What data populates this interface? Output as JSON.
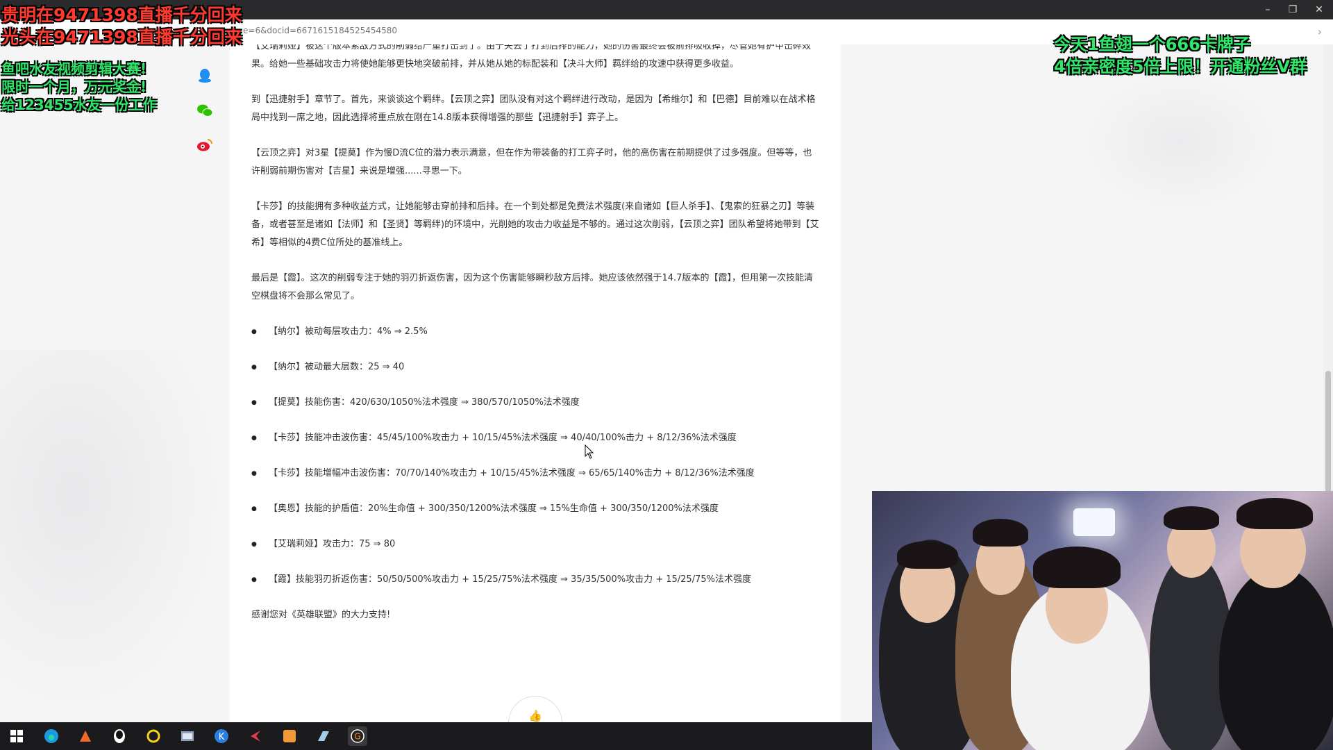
{
  "browser": {
    "url": "e=6&docid=6671615184525454580",
    "forward_icon": "chevron-right-icon"
  },
  "article": {
    "paragraphs": [
      "【艾瑞莉娅】被这个版本紧敌方式的削弱给严重打击到了。由于失去了打到后排的能力，她的伤害最终会被前排吸收掉，尽管她有护甲击碎效果。给她一些基础攻击力将使她能够更快地突破前排，并从她从她的标配装和【决斗大师】羁绊给的攻速中获得更多收益。",
      "到【迅捷射手】章节了。首先，来谈谈这个羁绊。【云顶之弈】团队没有对这个羁绊进行改动，是因为【希维尔】和【巴德】目前难以在战术格局中找到一席之地，因此选择将重点放在刚在14.8版本获得增强的那些【迅捷射手】弈子上。",
      "【云顶之弈】对3星【提莫】作为慢D流C位的潜力表示满意，但在作为带装备的打工弈子时，他的高伤害在前期提供了过多强度。但等等，也许削弱前期伤害对【吉星】来说是增强......寻思一下。",
      "【卡莎】的技能拥有多种收益方式，让她能够击穿前排和后排。在一个到处都是免费法术强度(来自诸如【巨人杀手】、【鬼索的狂暴之刃】等装备，或者甚至是诸如【法师】和【圣贤】等羁绊)的环境中，光削她的攻击力收益是不够的。通过这次削弱，【云顶之弈】团队希望将她带到【艾希】等相似的4费C位所处的基准线上。",
      "最后是【霞】。这次的削弱专注于她的羽刃折返伤害，因为这个伤害能够瞬秒敌方后排。她应该依然强于14.7版本的【霞】，但用第一次技能清空棋盘将不会那么常见了。"
    ],
    "bullets": [
      "【纳尔】被动每层攻击力：4% ⇒ 2.5%",
      "【纳尔】被动最大层数：25 ⇒ 40",
      "【提莫】技能伤害：420/630/1050%法术强度 ⇒ 380/570/1050%法术强度",
      "【卡莎】技能冲击波伤害：45/45/100%攻击力 + 10/15/45%法术强度 ⇒ 40/40/100%击力 + 8/12/36%法术强度",
      "【卡莎】技能增幅冲击波伤害：70/70/140%攻击力 + 10/15/45%法术强度 ⇒ 65/65/140%击力 + 8/12/36%法术强度",
      "【奥恩】技能的护盾值：20%生命值 + 300/350/1200%法术强度 ⇒ 15%生命值 + 300/350/1200%法术强度",
      "【艾瑞莉娅】攻击力：75 ⇒ 80",
      "【霞】技能羽刃折返伤害：50/50/500%攻击力 + 15/25/75%法术强度 ⇒ 35/35/500%攻击力 + 15/25/75%法术强度"
    ],
    "closing": "感谢您对《英雄联盟》的大力支持!"
  },
  "share_icons": [
    "qq-icon",
    "wechat-icon",
    "weibo-icon"
  ],
  "overlays": {
    "red_lines": [
      "贵明在9471398直播千分回来",
      "光头在9471398直播千分回来"
    ],
    "green_lines": [
      "鱼吧水友视频剪辑大赛!",
      "限时一个月，万元奖金!",
      "给123455水友一份工作"
    ],
    "right_lines": [
      "今天1鱼翅一个666卡牌子",
      "4倍亲密度5倍上限！开通粉丝V群"
    ]
  },
  "taskbar": {
    "apps": [
      "windows-start-icon",
      "edge-icon",
      "browser-icon",
      "qq-penguin-icon",
      "circle-app-icon",
      "file-manager-icon",
      "k-app-icon",
      "red-app-icon",
      "game-launcher-icon",
      "notes-icon",
      "obs-g-icon"
    ]
  },
  "colors": {
    "overlay_red": "#ff3b2f",
    "overlay_green": "#2ee86a",
    "qq_blue": "#1e8ef0",
    "wechat_green": "#2dc100",
    "weibo_red": "#e6162d"
  }
}
